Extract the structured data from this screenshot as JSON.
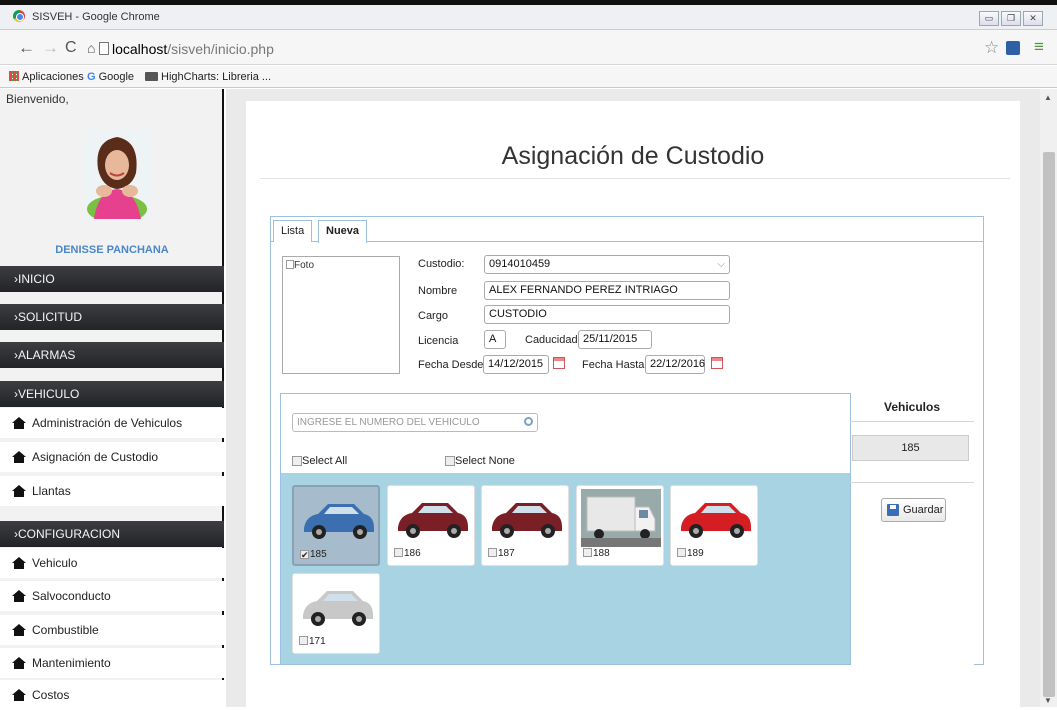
{
  "window": {
    "title": "SISVEH - Google Chrome"
  },
  "browser": {
    "url_host": "localhost",
    "url_path": "/sisveh/inicio.php"
  },
  "bookmarks": [
    {
      "label": "Aplicaciones",
      "icon": "apps-grid-icon"
    },
    {
      "label": "Google",
      "icon": "google-g-icon"
    },
    {
      "label": "HighCharts: Libreria ...",
      "icon": "folder-icon"
    }
  ],
  "sidebar": {
    "welcome": "Bienvenido,",
    "user_name": "DENISSE PANCHANA",
    "sections": {
      "inicio": "›INICIO",
      "solicitud": "›SOLICITUD",
      "alarmas": "›ALARMAS",
      "vehiculo": "›VEHICULO",
      "configuracion": "›CONFIGURACION"
    },
    "vehiculo_items": [
      "Administración de Vehiculos",
      "Asignación de Custodio",
      "Llantas"
    ],
    "config_items": [
      "Vehiculo",
      "Salvoconducto",
      "Combustible",
      "Mantenimiento",
      "Costos"
    ]
  },
  "page": {
    "title": "Asignación de Custodio"
  },
  "tabs": {
    "lista": "Lista",
    "nueva": "Nueva"
  },
  "form": {
    "foto_alt": "Foto",
    "custodio_label": "Custodio:",
    "custodio_value": "0914010459",
    "nombre_label": "Nombre",
    "nombre_value": "ALEX FERNANDO PEREZ INTRIAGO",
    "cargo_label": "Cargo",
    "cargo_value": "CUSTODIO",
    "licencia_label": "Licencia",
    "licencia_value": "A",
    "caducidad_label": "Caducidad",
    "caducidad_value": "25/11/2015",
    "fecha_desde_label": "Fecha Desde:",
    "fecha_desde_value": "14/12/2015",
    "fecha_hasta_label": "Fecha Hasta:",
    "fecha_hasta_value": "22/12/2016"
  },
  "vehicles": {
    "search_placeholder": "INGRESE EL NUMERO DEL VEHICULO",
    "select_all": "Select All",
    "select_none": "Select None",
    "list_header": "Vehiculos",
    "selected_value": "185",
    "save_label": "Guardar",
    "items": [
      {
        "id": "185",
        "checked": true,
        "color": "#3b6fb0"
      },
      {
        "id": "186",
        "checked": false,
        "color": "#7a1f26"
      },
      {
        "id": "187",
        "checked": false,
        "color": "#7a1f26"
      },
      {
        "id": "188",
        "checked": false,
        "color": "#e8e8e8"
      },
      {
        "id": "189",
        "checked": false,
        "color": "#d41e24"
      },
      {
        "id": "171",
        "checked": false,
        "color": "#c8c8c8"
      }
    ]
  },
  "colors": {
    "accent": "#4a86c8",
    "grid_bg": "#a7d3e3",
    "section_bg": "#2b2c2f"
  }
}
